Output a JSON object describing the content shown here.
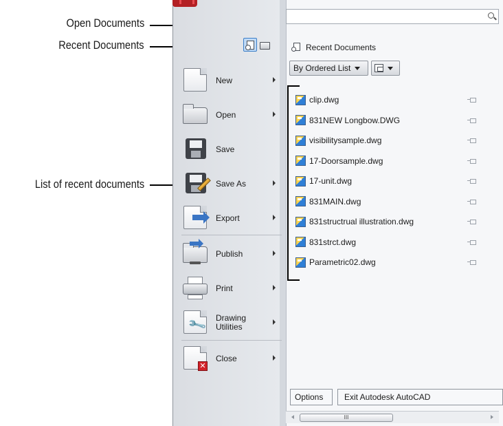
{
  "callouts": {
    "open_documents": "Open Documents",
    "recent_documents": "Recent Documents",
    "list_recent": "List of recent documents"
  },
  "search": {
    "placeholder": ""
  },
  "panel": {
    "title": "Recent Documents",
    "order_dropdown": "By Ordered List",
    "view_dropdown": ""
  },
  "commands": [
    {
      "label": "New",
      "icon": "new-document-icon",
      "submenu": true
    },
    {
      "label": "Open",
      "icon": "open-folder-icon",
      "submenu": true
    },
    {
      "label": "Save",
      "icon": "floppy-disk-icon",
      "submenu": false
    },
    {
      "label": "Save As",
      "icon": "save-as-icon",
      "submenu": true
    },
    {
      "label": "Export",
      "icon": "export-icon",
      "submenu": true
    },
    {
      "label": "Publish",
      "icon": "publish-icon",
      "submenu": true
    },
    {
      "label": "Print",
      "icon": "printer-icon",
      "submenu": true
    },
    {
      "label": "Drawing\nUtilities",
      "icon": "wrench-icon",
      "submenu": true
    },
    {
      "label": "Close",
      "icon": "close-document-icon",
      "submenu": true
    }
  ],
  "recent_files": [
    "clip.dwg",
    "831NEW Longbow.DWG",
    "visibilitysample.dwg",
    "17-Doorsample.dwg",
    "17-unit.dwg",
    "831MAIN.dwg",
    "831structrual illustration.dwg",
    "831strct.dwg",
    "Parametric02.dwg"
  ],
  "footer": {
    "options_label": "Options",
    "exit_label": "Exit Autodesk AutoCAD"
  },
  "scrollbar": {
    "thumb_label": "III"
  },
  "colors": {
    "accent": "#3c7fc8",
    "app_button": "#b32024",
    "close_badge": "#d2232a"
  }
}
